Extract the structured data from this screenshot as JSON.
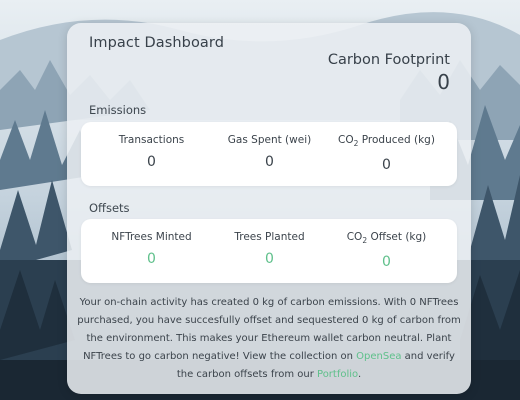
{
  "dashboard": {
    "title": "Impact Dashboard",
    "footprint_label": "Carbon Footprint",
    "footprint_value": "0"
  },
  "emissions": {
    "section_label": "Emissions",
    "transactions_label": "Transactions",
    "transactions_value": "0",
    "gas_label": "Gas Spent (wei)",
    "gas_value": "0",
    "co2_prefix": "CO",
    "co2_sub": "2",
    "co2_suffix": " Produced (kg)",
    "co2_value": "0"
  },
  "offsets": {
    "section_label": "Offsets",
    "nftrees_label": "NFTrees Minted",
    "nftrees_value": "0",
    "planted_label": "Trees Planted",
    "planted_value": "0",
    "co2_prefix": "CO",
    "co2_sub": "2",
    "co2_suffix": " Offset (kg)",
    "co2_value": "0"
  },
  "description": {
    "part1": "Your on-chain activity has created 0 kg of carbon emissions. With 0 NFTrees purchased, you have succesfully offset and sequestered 0 kg of carbon from the environment. This makes your Ethereum wallet carbon neutral. Plant NFTrees to go carbon negative! View the collection on ",
    "link1": "OpenSea",
    "part2": " and verify the carbon offsets from our ",
    "link2": "Portfolio",
    "part3": "."
  },
  "colors": {
    "accent_green": "#5fc08b",
    "text_dark": "#38414a",
    "panel_bg": "#ffffff"
  }
}
